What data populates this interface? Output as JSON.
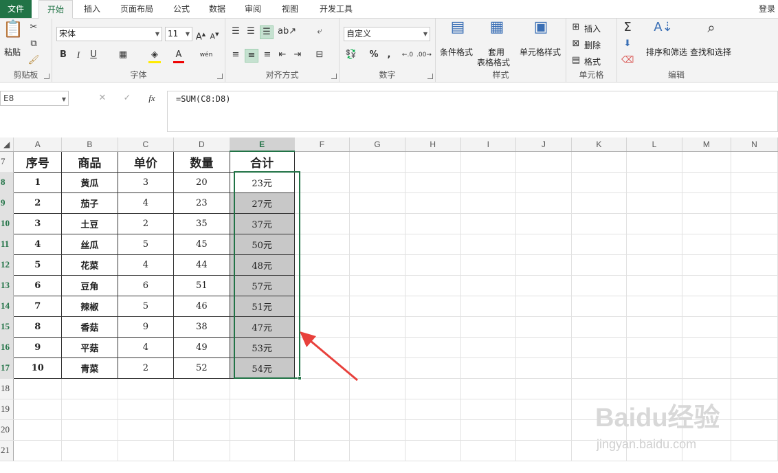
{
  "tabs": {
    "file": "文件",
    "home": "开始",
    "insert": "插入",
    "layout": "页面布局",
    "formulas": "公式",
    "data": "数据",
    "review": "审阅",
    "view": "视图",
    "developer": "开发工具",
    "login": "登录"
  },
  "ribbon": {
    "clipboard": {
      "paste": "粘贴",
      "label": "剪贴板"
    },
    "font": {
      "name": "宋体",
      "size": "11",
      "label": "字体"
    },
    "alignment": {
      "label": "对齐方式"
    },
    "number": {
      "format": "自定义",
      "label": "数字",
      "percent": "%",
      "comma": ","
    },
    "styles": {
      "conditional": "条件格式",
      "table_line1": "套用",
      "table_line2": "表格格式",
      "cell_styles": "单元格样式",
      "label": "样式"
    },
    "cells": {
      "insert": "插入",
      "delete": "删除",
      "format": "格式",
      "label": "单元格"
    },
    "editing": {
      "sort": "排序和筛选",
      "find": "查找和选择",
      "label": "编辑"
    }
  },
  "formula_bar": {
    "name_box": "E8",
    "fx": "fx",
    "formula": "=SUM(C8:D8)"
  },
  "columns": [
    "A",
    "B",
    "C",
    "D",
    "E",
    "F",
    "G",
    "H",
    "I",
    "J",
    "K",
    "L",
    "M",
    "N"
  ],
  "headers": {
    "row": "7",
    "a": "序号",
    "b": "商品",
    "c": "单价",
    "d": "数量",
    "e": "合计"
  },
  "rows": [
    {
      "row": "8",
      "a": "1",
      "b": "黄瓜",
      "c": "3",
      "d": "20",
      "e": "23元"
    },
    {
      "row": "9",
      "a": "2",
      "b": "茄子",
      "c": "4",
      "d": "23",
      "e": "27元"
    },
    {
      "row": "10",
      "a": "3",
      "b": "土豆",
      "c": "2",
      "d": "35",
      "e": "37元"
    },
    {
      "row": "11",
      "a": "4",
      "b": "丝瓜",
      "c": "5",
      "d": "45",
      "e": "50元"
    },
    {
      "row": "12",
      "a": "5",
      "b": "花菜",
      "c": "4",
      "d": "44",
      "e": "48元"
    },
    {
      "row": "13",
      "a": "6",
      "b": "豆角",
      "c": "6",
      "d": "51",
      "e": "57元"
    },
    {
      "row": "14",
      "a": "7",
      "b": "辣椒",
      "c": "5",
      "d": "46",
      "e": "51元"
    },
    {
      "row": "15",
      "a": "8",
      "b": "香菇",
      "c": "9",
      "d": "38",
      "e": "47元"
    },
    {
      "row": "16",
      "a": "9",
      "b": "平菇",
      "c": "4",
      "d": "49",
      "e": "53元"
    },
    {
      "row": "17",
      "a": "10",
      "b": "青菜",
      "c": "2",
      "d": "52",
      "e": "54元"
    }
  ],
  "empty_rows": [
    "18",
    "19",
    "20",
    "21"
  ],
  "watermark": {
    "brand": "Baidu经验",
    "url": "jingyan.baidu.com"
  },
  "colors": {
    "accent": "#217346",
    "selection_fill": "#c8c8c8",
    "arrow": "#e8413c"
  }
}
